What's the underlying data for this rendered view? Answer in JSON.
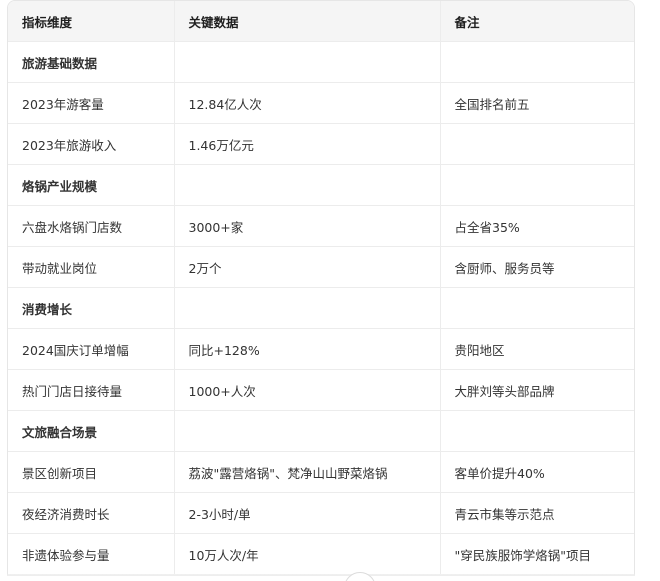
{
  "table": {
    "headers": [
      "指标维度",
      "关键数据",
      "备注"
    ],
    "rows": [
      {
        "type": "section",
        "cells": [
          "旅游基础数据",
          "",
          ""
        ]
      },
      {
        "type": "data",
        "cells": [
          "2023年游客量",
          "12.84亿人次",
          "全国排名前五"
        ]
      },
      {
        "type": "data",
        "cells": [
          "2023年旅游收入",
          "1.46万亿元",
          ""
        ]
      },
      {
        "type": "section",
        "cells": [
          "烙锅产业规模",
          "",
          ""
        ]
      },
      {
        "type": "data",
        "cells": [
          "六盘水烙锅门店数",
          "3000+家",
          "占全省35%"
        ]
      },
      {
        "type": "data",
        "cells": [
          "带动就业岗位",
          "2万个",
          "含厨师、服务员等"
        ]
      },
      {
        "type": "section",
        "cells": [
          "消费增长",
          "",
          ""
        ]
      },
      {
        "type": "data",
        "cells": [
          "2024国庆订单增幅",
          "同比+128%",
          "贵阳地区"
        ]
      },
      {
        "type": "data",
        "cells": [
          "热门门店日接待量",
          "1000+人次",
          "大胖刘等头部品牌"
        ]
      },
      {
        "type": "section",
        "cells": [
          "文旅融合场景",
          "",
          ""
        ]
      },
      {
        "type": "data",
        "cells": [
          "景区创新项目",
          "荔波\"露营烙锅\"、梵净山山野菜烙锅",
          "客单价提升40%"
        ]
      },
      {
        "type": "data",
        "cells": [
          "夜经济消费时长",
          "2-3小时/单",
          "青云市集等示范点"
        ]
      },
      {
        "type": "data",
        "cells": [
          "非遗体验参与量",
          "10万人次/年",
          "\"穿民族服饰学烙锅\"项目"
        ]
      }
    ]
  }
}
